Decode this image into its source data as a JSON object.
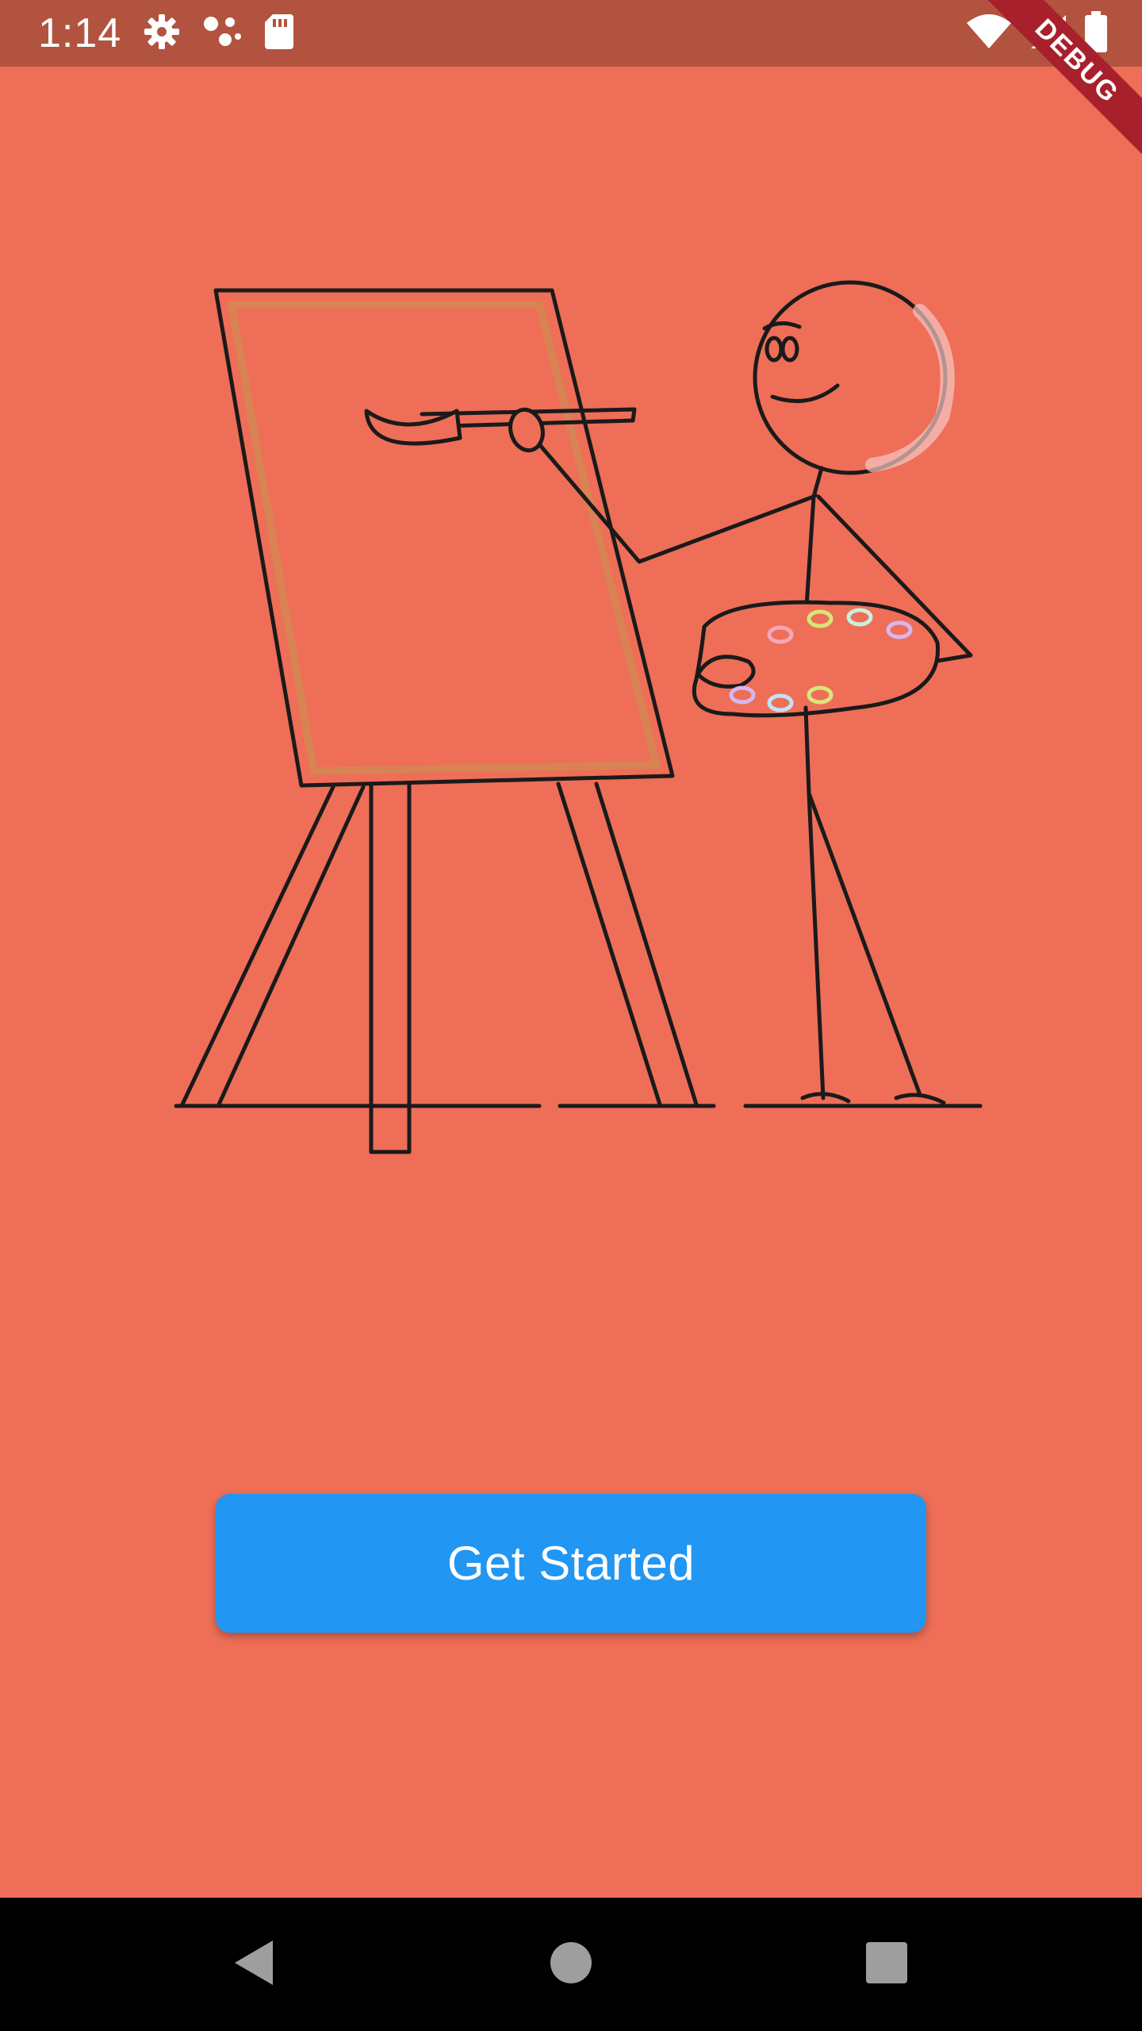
{
  "status_bar": {
    "time": "1:14",
    "left_icons": [
      "gear-icon",
      "assistant-icon",
      "sd-card-icon"
    ],
    "right_icons": [
      "wifi-icon",
      "cellular-icon",
      "battery-icon"
    ],
    "color": "#B2533F"
  },
  "debug_banner": {
    "label": "DEBUG",
    "color": "#A8202C"
  },
  "illustration": {
    "icon": "stick-figure-painter-illustration",
    "palette_colors": [
      "#F6A7B8",
      "#D8E678",
      "#C9F0D8",
      "#D7B6F0",
      "#D7B6F0",
      "#BFE3F5",
      "#D8E678"
    ]
  },
  "main": {
    "background_color": "#EE6E57",
    "button": {
      "label": "Get Started",
      "color": "#2196F3"
    }
  },
  "nav_bar": {
    "icons": [
      "back-icon",
      "home-icon",
      "recents-icon"
    ]
  }
}
